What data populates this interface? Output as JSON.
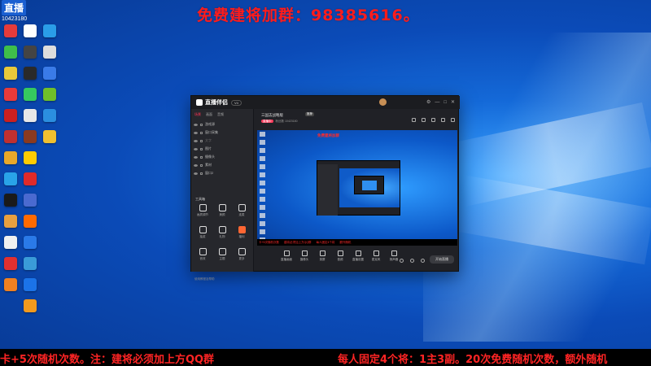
{
  "top_banner": "免费建将加群：98385616。",
  "logo": {
    "mark": "直播",
    "number": "10423180"
  },
  "desktop_icons": [
    {
      "label": "",
      "color": "#e63b3b"
    },
    {
      "label": "",
      "color": "#ffffff"
    },
    {
      "label": "",
      "color": "#2a9de8"
    },
    {
      "label": "",
      "color": "#3fbf4a"
    },
    {
      "label": "",
      "color": "#444444"
    },
    {
      "label": "",
      "color": "#dddddd"
    },
    {
      "label": "",
      "color": "#e8c93a"
    },
    {
      "label": "",
      "color": "#2a2a2a"
    },
    {
      "label": "",
      "color": "#3a7be8"
    },
    {
      "label": "",
      "color": "#e83a3a"
    },
    {
      "label": "",
      "color": "#36c95f"
    },
    {
      "label": "",
      "color": "#6fbf2a"
    },
    {
      "label": "",
      "color": "#cc2020"
    },
    {
      "label": "",
      "color": "#e8e8e8"
    },
    {
      "label": "",
      "color": "#2b8fe0"
    },
    {
      "label": "",
      "color": "#c03030"
    },
    {
      "label": "",
      "color": "#8a3a20"
    },
    {
      "label": "",
      "color": "#f0c030"
    },
    {
      "label": "",
      "color": "#e8a82a"
    },
    {
      "label": "",
      "color": "#ffcc00"
    },
    {
      "label": "",
      "color": "#29a3e8"
    },
    {
      "label": "",
      "color": "#e02a2a"
    },
    {
      "label": "",
      "color": "#1a1a1a"
    },
    {
      "label": "",
      "color": "#4a6ad0"
    },
    {
      "label": "",
      "color": "#e8a040"
    },
    {
      "label": "",
      "color": "#ff6a00"
    },
    {
      "label": "",
      "color": "#f0f0f0"
    },
    {
      "label": "",
      "color": "#2a7ae8"
    },
    {
      "label": "",
      "color": "#e23030"
    },
    {
      "label": "",
      "color": "#3a9bd8"
    },
    {
      "label": "",
      "color": "#f08020"
    },
    {
      "label": "",
      "color": "#1b73e8"
    },
    {
      "label": "",
      "color": "#f29a1e"
    }
  ],
  "app": {
    "name": "直播伴侣",
    "badge": "V4",
    "left_tabs": [
      "场景",
      "画面",
      "音频"
    ],
    "scenes": [
      {
        "label": "游戏源",
        "dim": false
      },
      {
        "label": "窗口采集",
        "dim": false
      },
      {
        "label": "文字",
        "dim": true
      },
      {
        "label": "图片",
        "dim": false
      },
      {
        "label": "摄像头",
        "dim": false
      },
      {
        "label": "素材",
        "dim": false
      },
      {
        "label": "窗口2",
        "dim": false
      }
    ],
    "tools_title": "工具箱",
    "tools": [
      {
        "label": "画质调节",
        "hot": false
      },
      {
        "label": "美颜",
        "hot": false
      },
      {
        "label": "连麦",
        "hot": false
      },
      {
        "label": "抽奖",
        "hot": false
      },
      {
        "label": "礼物",
        "hot": false
      },
      {
        "label": "福利",
        "hot": true
      },
      {
        "label": "音效",
        "hot": false
      },
      {
        "label": "主题",
        "hot": false
      },
      {
        "label": "更多",
        "hot": false
      }
    ],
    "footnote": "使用教程及帮助",
    "room_title": "三国志战略版",
    "room_tag": "推荐",
    "room_sub_pill": "直播中",
    "room_sub": "粉丝数 10423180",
    "preview_title": "免费建将加群",
    "preview_ticker": [
      "卡+5次随机次数",
      "建将必须加上方QQ群",
      "每人固定4个将",
      "额外随机"
    ],
    "bottom_tools": [
      "直播画面",
      "摄像头",
      "录屏",
      "音频",
      "直播设置",
      "麦克风",
      "扬声器"
    ],
    "start_button": "开始直播"
  },
  "ticker": [
    "卡+5次随机次数。注：建将必须加上方QQ群",
    "每人固定4个将：1主3副。20次免费随机次数，额外随机"
  ]
}
